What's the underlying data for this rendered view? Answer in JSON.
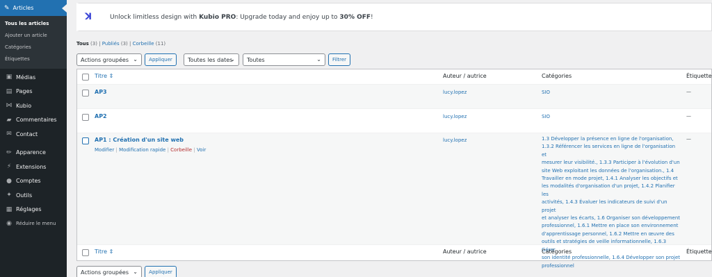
{
  "sidebar": {
    "active": {
      "icon": "pin-icon",
      "label": "Articles"
    },
    "submenu": [
      "Tous les articles",
      "Ajouter un article",
      "Catégories",
      "Étiquettes"
    ],
    "items": [
      {
        "icon": "media-icon",
        "label": "Médias"
      },
      {
        "icon": "pages-icon",
        "label": "Pages"
      },
      {
        "icon": "kubio-icon",
        "label": "Kubio"
      },
      {
        "icon": "comments-icon",
        "label": "Commentaires"
      },
      {
        "icon": "mail-icon",
        "label": "Contact"
      },
      {
        "icon": "appearance-icon",
        "label": "Apparence"
      },
      {
        "icon": "plugin-icon",
        "label": "Extensions"
      },
      {
        "icon": "users-icon",
        "label": "Comptes"
      },
      {
        "icon": "tools-icon",
        "label": "Outils"
      },
      {
        "icon": "settings-icon",
        "label": "Réglages"
      },
      {
        "icon": "collapse-icon",
        "label": "Réduire le menu"
      }
    ]
  },
  "notice": {
    "prefix": "Unlock limitless design with ",
    "brand": "Kubio PRO",
    "middle": ": Upgrade today and enjoy up to ",
    "discount": "30% OFF",
    "suffix": "!"
  },
  "filters": {
    "all_label": "Tous",
    "all_count": "(3)",
    "published_label": "Publiés",
    "published_count": "(3)",
    "trash_label": "Corbeille",
    "trash_count": "(11)",
    "sep": "|"
  },
  "toolbar": {
    "bulk_actions": "Actions groupées",
    "apply": "Appliquer",
    "dates": "Toutes les dates",
    "categories": "Toutes",
    "filter": "Filtrer"
  },
  "table": {
    "headers": {
      "title": "Titre",
      "author": "Auteur / autrice",
      "categories": "Catégories",
      "tags": "Étiquettes"
    },
    "rows": [
      {
        "title": "AP3",
        "author": "lucy.lopez",
        "categories": "SIO",
        "tags": "—"
      },
      {
        "title": "AP2",
        "author": "lucy.lopez",
        "categories": "SIO",
        "tags": "—"
      },
      {
        "title": "AP1 : Création d'un site web",
        "author": "lucy.lopez",
        "tags": "—",
        "row_actions": [
          "Modifier",
          "Modification rapide",
          "Corbeille",
          "Voir"
        ],
        "category_lines": [
          "1.3 Développer la présence en ligne de l'organisation,",
          "1.3.2 Référencer les services en ligne de l'organisation et",
          "mesurer leur visibilité., 1.3.3 Participer à l'évolution d'un",
          "site Web exploitant les données de l'organisation., 1.4",
          "Travailler en mode projet, 1.4.1 Analyser les objectifs et",
          "les modalités d'organisation d'un projet, 1.4.2 Planifier les",
          "activités, 1.4.3 Évaluer les indicateurs de suivi d'un projet",
          "et analyser les écarts, 1.6 Organiser son développement",
          "professionnel, 1.6.1 Mettre en place son environnement",
          "d'apprentissage personnel, 1.6.2 Mettre en œuvre des",
          "outils et stratégies de veille informationnelle, 1.6.3 Gérer",
          "son identité professionnelle, 1.6.4 Développer son projet",
          "professionnel"
        ]
      }
    ]
  },
  "colors": {
    "accent": "#2271b1",
    "sidebar": "#1d2327",
    "trash": "#b32d2e"
  }
}
